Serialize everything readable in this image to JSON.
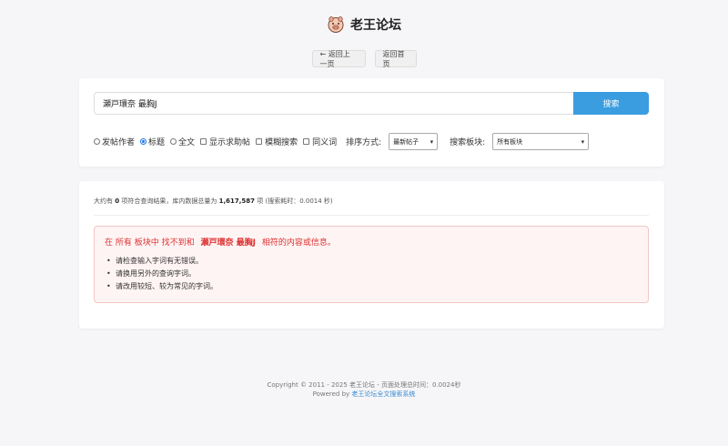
{
  "header": {
    "title": "老王论坛",
    "logo_icon": "pig-face-icon"
  },
  "nav": {
    "back_label": "← 返回上一页",
    "home_label": "返回首页"
  },
  "search": {
    "query": "瀬戸環奈 最胸J",
    "button_label": "搜索"
  },
  "options": {
    "search_in": [
      {
        "label": "发帖作者",
        "checked": false
      },
      {
        "label": "标题",
        "checked": true
      },
      {
        "label": "全文",
        "checked": false
      }
    ],
    "checkboxes": [
      {
        "label": "显示求助帖",
        "checked": false
      },
      {
        "label": "模糊搜索",
        "checked": false
      },
      {
        "label": "同义词",
        "checked": false
      }
    ],
    "sort_label": "排序方式:",
    "sort_value": "最新帖子",
    "forum_label": "搜索板块:",
    "forum_value": "所有板块"
  },
  "results": {
    "stats_prefix": "大约有",
    "count": "0",
    "stats_mid": "项符合查询结果，库内数据总量为",
    "total": "1,617,587",
    "stats_suffix": "项 (搜索耗时：0.0014 秒)",
    "notice": {
      "pre": "在 所有 板块中 找不到和",
      "keyword": "瀬戸環奈 最胸J",
      "post": "相符的内容或信息。",
      "tips": [
        "请检查输入字词有无错误。",
        "请换用另外的查询字词。",
        "请改用较短、较为常见的字词。"
      ]
    }
  },
  "footer": {
    "line1": "Copyright © 2011 - 2025 老王论坛 - 页面处理总时间：0.0024秒",
    "powered_prefix": "Powered by",
    "powered_link": "老王论坛全文搜索系统"
  },
  "colors": {
    "accent": "#3a9de0",
    "notice_text": "#dd3333",
    "notice_bg": "#fff4f4"
  }
}
